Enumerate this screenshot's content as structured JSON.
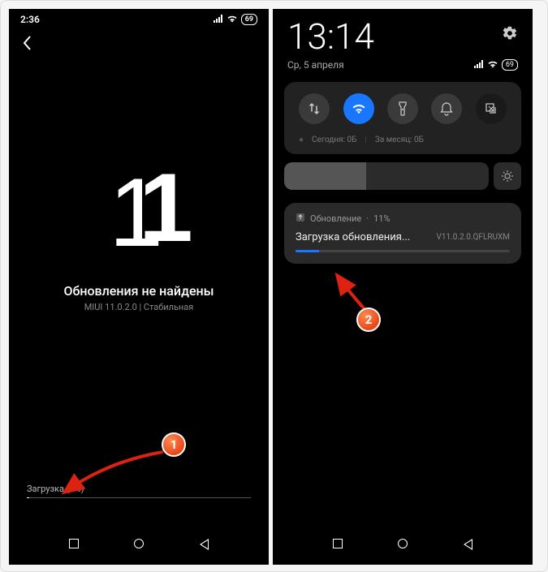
{
  "left": {
    "status_time": "2:36",
    "battery": "69",
    "update_status": "Обновления не найдены",
    "version_line": "MIUI 11.0.2.0 | Стабильная",
    "download_label": "Загрузка (1%)"
  },
  "right": {
    "clock": "13:14",
    "date": "Ср, 5 апреля",
    "battery": "69",
    "qs_tiles": [
      {
        "name": "data-toggle-icon",
        "glyph": "⇅",
        "active": false
      },
      {
        "name": "wifi-toggle-icon",
        "glyph": "✶",
        "active": true
      },
      {
        "name": "flashlight-toggle-icon",
        "glyph": "⚒",
        "active": false
      },
      {
        "name": "dnd-toggle-icon",
        "glyph": "♫",
        "active": false
      },
      {
        "name": "screenshot-toggle-icon",
        "glyph": "⧉",
        "active": false
      }
    ],
    "data_today_label": "Сегодня: 0Б",
    "data_month_label": "За месяц: 0Б",
    "notification": {
      "app_label": "Обновление",
      "percent_label": "11%",
      "title": "Загрузка обновления...",
      "version": "V11.0.2.0.QFLRUXM",
      "progress_percent": 11
    }
  },
  "callouts": {
    "one": "1",
    "two": "2"
  }
}
